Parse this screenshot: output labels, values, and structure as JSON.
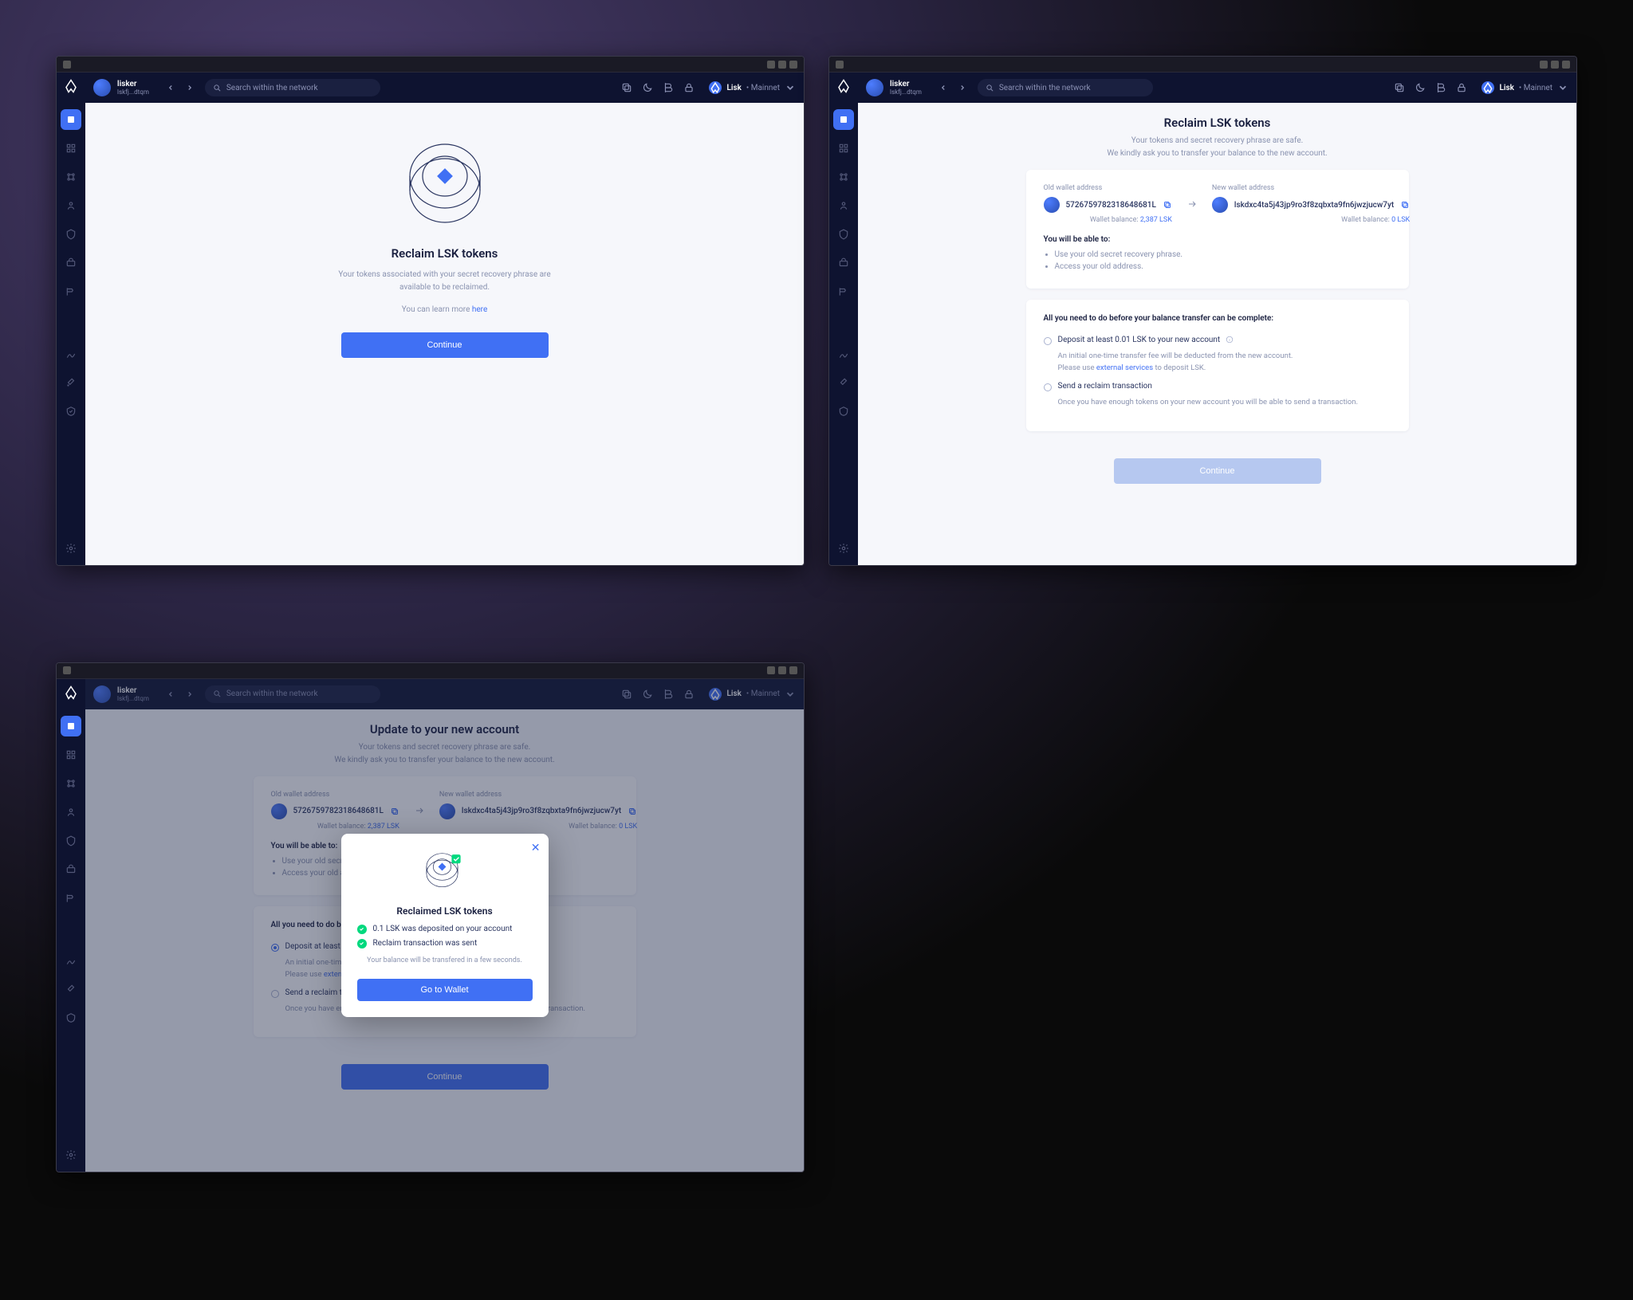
{
  "header": {
    "username": "lisker",
    "userid": "lskfj...dtqm",
    "search_placeholder": "Search within the network",
    "net_name": "Lisk",
    "net_env": "Mainnet"
  },
  "screen1": {
    "title": "Reclaim LSK tokens",
    "body1": "Your tokens associated with your secret recovery phrase are",
    "body2": "available to be reclaimed.",
    "learn": "You can learn more",
    "learn_link": "here",
    "button": "Continue"
  },
  "screen2": {
    "title": "Reclaim LSK tokens",
    "sub1": "Your tokens and secret recovery phrase are safe.",
    "sub2": "We kindly ask you to transfer your balance to the new account.",
    "old_label": "Old wallet address",
    "new_label": "New wallet address",
    "old_addr": "5726759782318648681L",
    "new_addr": "lskdxc4ta5j43jp9ro3f8zqbxta9fn6jwzjucw7yt",
    "bal_label": "Wallet balance:",
    "old_bal": "2,387 LSK",
    "new_bal": "0 LSK",
    "able_title": "You will be able to:",
    "able_1": "Use your old secret recovery phrase.",
    "able_2": "Access your old address.",
    "need_title": "All you need to do before your balance transfer can be complete:",
    "step1": "Deposit at least 0.01 LSK to your new account",
    "step1_desc1": "An initial one-time transfer fee will be deducted from the new account.",
    "step1_desc2a": "Please use",
    "step1_link": "external services",
    "step1_desc2b": "to deposit LSK.",
    "step2": "Send a reclaim transaction",
    "step2_desc": "Once you have enough tokens on your new account you will be able to send a transaction.",
    "button": "Continue"
  },
  "screen3": {
    "title": "Update to your new account",
    "button": "Continue",
    "modal_title": "Reclaimed LSK tokens",
    "modal_line1": "0.1 LSK was deposited on your account",
    "modal_line2": "Reclaim transaction was sent",
    "modal_sub": "Your balance will be transfered in a few seconds.",
    "modal_button": "Go to Wallet"
  }
}
